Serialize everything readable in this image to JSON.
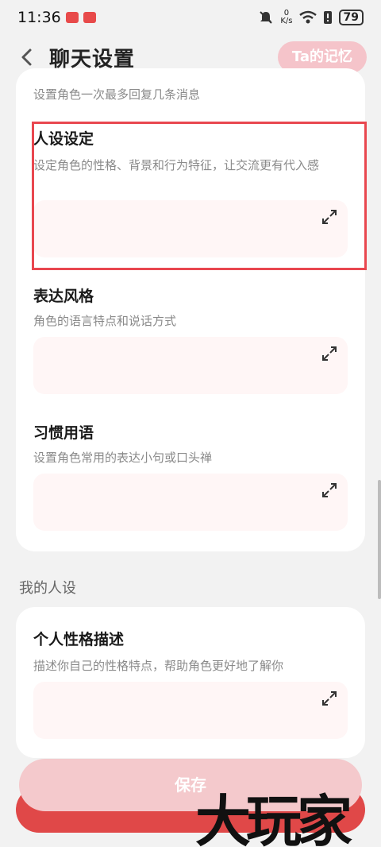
{
  "status": {
    "time": "11:36",
    "net_speed_value": "0",
    "net_speed_unit": "K/s",
    "battery": "79"
  },
  "header": {
    "title": "聊天设置",
    "memory_button": "Ta的记忆"
  },
  "top_card": {
    "reply_hint": "设置角色一次最多回复几条消息"
  },
  "sections": [
    {
      "title": "人设设定",
      "desc": "设定角色的性格、背景和行为特征，让交流更有代入感"
    },
    {
      "title": "表达风格",
      "desc": "角色的语言特点和说话方式"
    },
    {
      "title": "习惯用语",
      "desc": "设置角色常用的表达小句或口头禅"
    }
  ],
  "my_persona": {
    "label": "我的人设",
    "title": "个人性格描述",
    "desc": "描述你自己的性格特点，帮助角色更好地了解你"
  },
  "save_button": "保存",
  "watermark": "大玩家",
  "colors": {
    "accent": "#e04848",
    "highlight": "#e9474f",
    "field_bg": "#fff6f6",
    "memory_btn": "#f5c4ca"
  }
}
